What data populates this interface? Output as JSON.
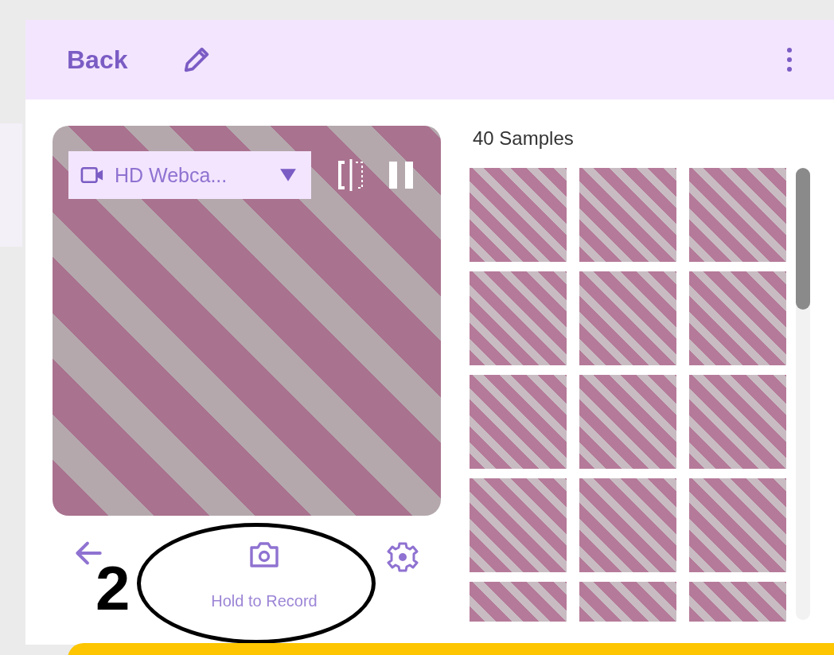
{
  "header": {
    "title": "Back"
  },
  "webcam": {
    "device": "HD Webca..."
  },
  "record_button": {
    "label": "Hold to Record"
  },
  "samples": {
    "count_label": "40 Samples"
  },
  "annotation": {
    "number": "2"
  }
}
